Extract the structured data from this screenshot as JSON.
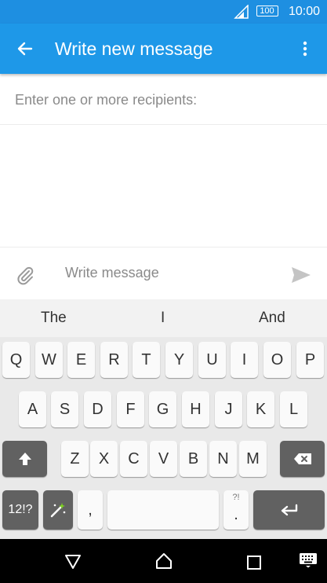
{
  "status": {
    "battery": "100",
    "time": "10:00"
  },
  "appbar": {
    "title": "Write new message"
  },
  "recipients": {
    "placeholder": "Enter one or more recipients:"
  },
  "compose": {
    "placeholder": "Write message"
  },
  "suggestions": [
    "The",
    "I",
    "And"
  ],
  "keyboard": {
    "row1": [
      "Q",
      "W",
      "E",
      "R",
      "T",
      "Y",
      "U",
      "I",
      "O",
      "P"
    ],
    "row2": [
      "A",
      "S",
      "D",
      "F",
      "G",
      "H",
      "J",
      "K",
      "L"
    ],
    "row3": [
      "Z",
      "X",
      "C",
      "V",
      "B",
      "N",
      "M"
    ],
    "symbols_label": "12!?",
    "comma": ",",
    "period": ".",
    "period_alt": "?!"
  },
  "colors": {
    "appbar": "#1e98e8",
    "statusbar": "#1e8fe1",
    "dark_key": "#616161"
  }
}
